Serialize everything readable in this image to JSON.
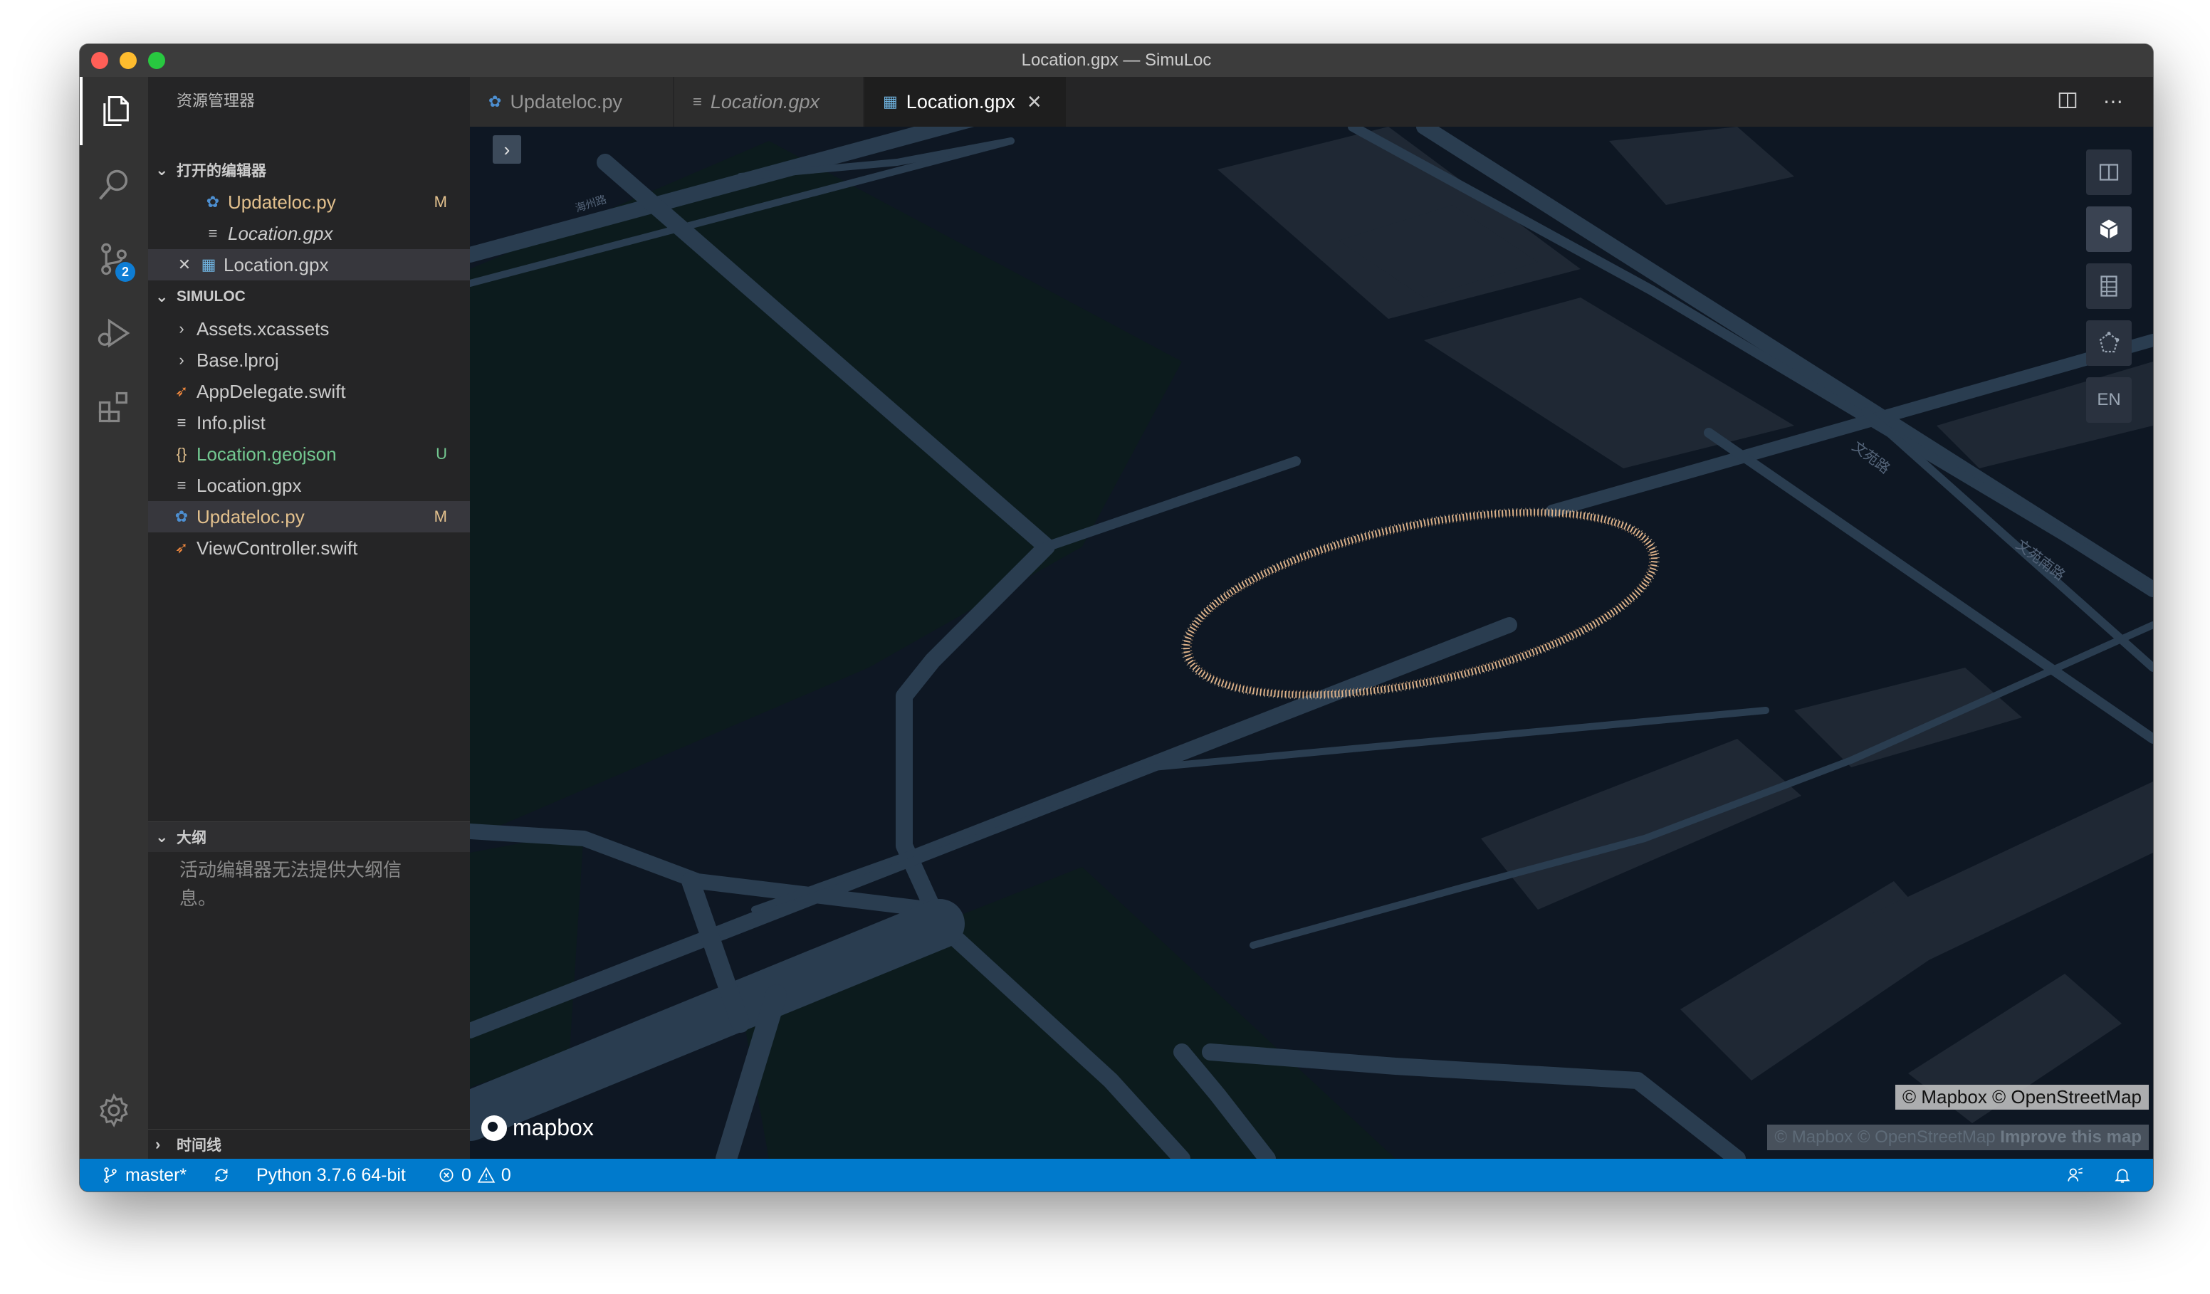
{
  "window": {
    "title": "Location.gpx — SimuLoc"
  },
  "activity_bar": {
    "items": [
      "explorer",
      "search",
      "source-control",
      "run-debug",
      "extensions",
      "settings"
    ],
    "scm_badge": "2"
  },
  "sidebar": {
    "title": "资源管理器",
    "open_editors": {
      "header": "打开的编辑器",
      "items": [
        {
          "label": "Updateloc.py",
          "status": "M",
          "icon": "python-icon",
          "color": "#e2c08d"
        },
        {
          "label": "Location.gpx",
          "status": "",
          "icon": "lines-icon",
          "color": "#cccccc"
        },
        {
          "label": "Location.gpx",
          "status": "",
          "icon": "map-icon",
          "color": "#cccccc"
        }
      ]
    },
    "project": {
      "header": "SIMULOC",
      "items": [
        {
          "label": "Assets.xcassets",
          "type": "folder",
          "status": ""
        },
        {
          "label": "Base.lproj",
          "type": "folder",
          "status": ""
        },
        {
          "label": "AppDelegate.swift",
          "type": "swift",
          "status": ""
        },
        {
          "label": "Info.plist",
          "type": "plain",
          "status": ""
        },
        {
          "label": "Location.geojson",
          "type": "json",
          "status": "U",
          "color": "#73c991"
        },
        {
          "label": "Location.gpx",
          "type": "plain",
          "status": ""
        },
        {
          "label": "Updateloc.py",
          "type": "python",
          "status": "M",
          "color": "#e2c08d"
        },
        {
          "label": "ViewController.swift",
          "type": "swift",
          "status": ""
        }
      ]
    },
    "outline": {
      "header": "大纲",
      "message": "活动编辑器无法提供大纲信息。"
    },
    "timeline": {
      "header": "时间线"
    }
  },
  "tabs": [
    {
      "label": "Updateloc.py",
      "icon": "python-icon",
      "active": false
    },
    {
      "label": "Location.gpx",
      "icon": "lines-icon",
      "active": false
    },
    {
      "label": "Location.gpx",
      "icon": "map-icon",
      "active": true
    }
  ],
  "map": {
    "street_labels": [
      "海州路",
      "文苑路",
      "文苑南路"
    ],
    "controls": [
      "split-icon",
      "3d-cube-icon",
      "table-icon",
      "polygon-icon",
      "EN"
    ],
    "logo": "mapbox",
    "attribution": "© Mapbox © OpenStreetMap",
    "attribution_secondary": "© Mapbox © OpenStreetMap",
    "improve_link": "Improve this map",
    "track_color": "#e8b98e"
  },
  "status_bar": {
    "branch": "master*",
    "python": "Python 3.7.6 64-bit",
    "errors": "0",
    "warnings": "0"
  }
}
